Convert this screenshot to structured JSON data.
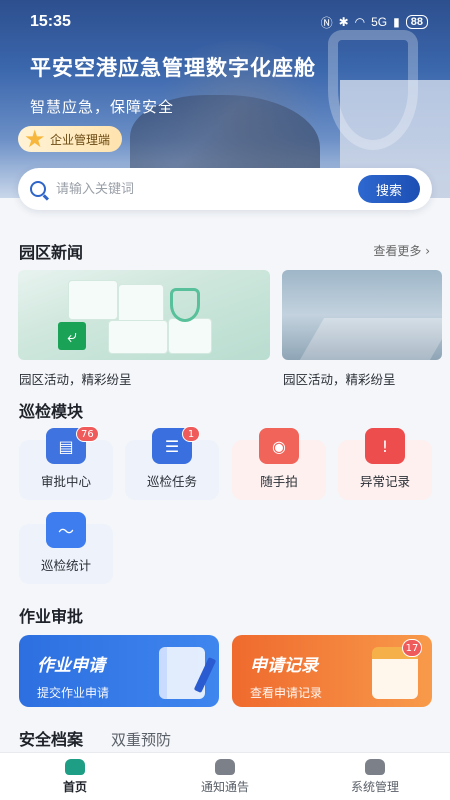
{
  "status_bar": {
    "time": "15:35",
    "network": "5G",
    "battery": "88"
  },
  "hero": {
    "title": "平安空港应急管理数字化座舱",
    "subtitle": "智慧应急，保障安全",
    "org_badge": "企业管理端"
  },
  "search": {
    "placeholder": "请输入关键词",
    "button": "搜索"
  },
  "news": {
    "title": "园区新闻",
    "more": "查看更多",
    "items": [
      {
        "caption": "园区活动，精彩纷呈"
      },
      {
        "caption": "园区活动，精彩纷呈"
      }
    ]
  },
  "inspection": {
    "title": "巡检模块",
    "tiles": [
      {
        "label": "审批中心",
        "badge": "76",
        "icon": "approval-doc-icon",
        "color": "#3f74e0"
      },
      {
        "label": "巡检任务",
        "badge": "1",
        "icon": "task-list-icon",
        "color": "#3a6fe0"
      },
      {
        "label": "随手拍",
        "badge": "",
        "icon": "camera-icon",
        "color": "#f0645a"
      },
      {
        "label": "异常记录",
        "badge": "",
        "icon": "alert-icon",
        "color": "#ee4d4d"
      },
      {
        "label": "巡检统计",
        "badge": "",
        "icon": "chart-line-icon",
        "color": "#3d7df0"
      }
    ]
  },
  "approval": {
    "title": "作业审批",
    "cards": [
      {
        "title": "作业申请",
        "subtitle": "提交作业申请",
        "badge": ""
      },
      {
        "title": "申请记录",
        "subtitle": "查看申请记录",
        "badge": "17"
      }
    ]
  },
  "tabs": {
    "active": "安全档案",
    "other": "双重预防"
  },
  "nav": [
    {
      "label": "首页",
      "icon": "home-icon"
    },
    {
      "label": "通知通告",
      "icon": "bell-icon"
    },
    {
      "label": "系统管理",
      "icon": "settings-icon"
    }
  ],
  "colors": {
    "primary": "#2d68d0",
    "accent": "#ef6a2e",
    "badge": "#ef5a5a"
  }
}
